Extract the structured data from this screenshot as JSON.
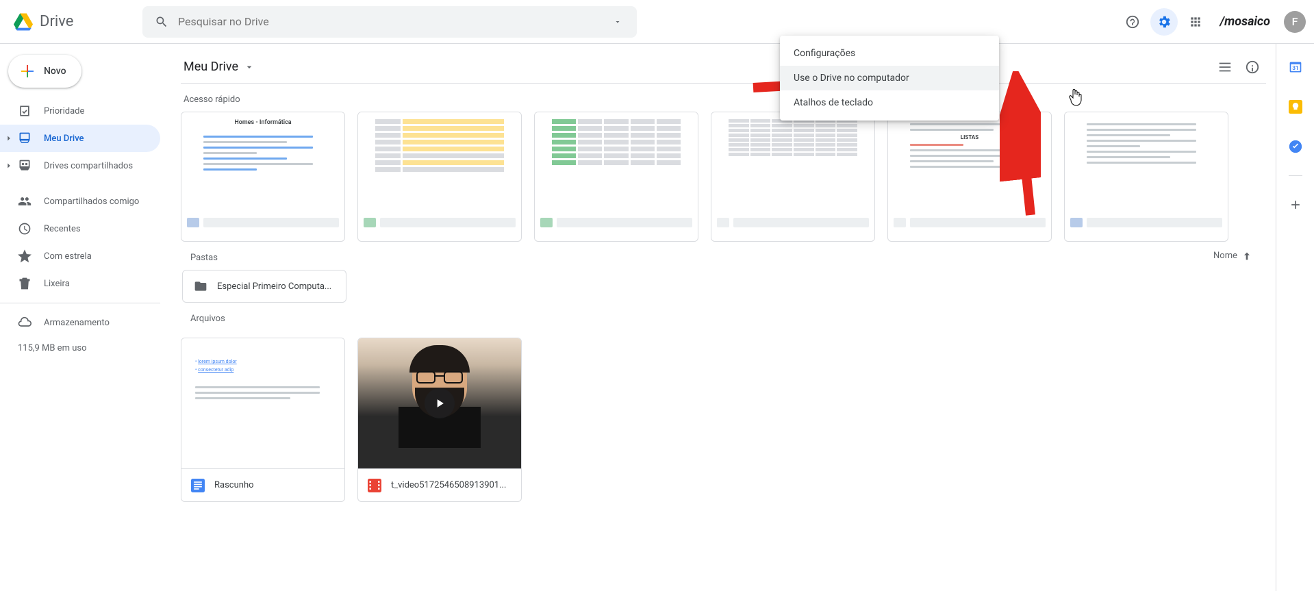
{
  "header": {
    "app_title": "Drive",
    "search_placeholder": "Pesquisar no Drive",
    "brand": "/mosaico",
    "avatar_initial": "F"
  },
  "sidebar": {
    "new_label": "Novo",
    "items": [
      {
        "label": "Prioridade"
      },
      {
        "label": "Meu Drive"
      },
      {
        "label": "Drives compartilhados"
      },
      {
        "label": "Compartilhados comigo"
      },
      {
        "label": "Recentes"
      },
      {
        "label": "Com estrela"
      },
      {
        "label": "Lixeira"
      },
      {
        "label": "Armazenamento"
      }
    ],
    "storage_used": "115,9 MB em uso"
  },
  "main": {
    "path_label": "Meu Drive",
    "quick_access_title": "Acesso rápido",
    "folders_title": "Pastas",
    "files_title": "Arquivos",
    "sort_label": "Nome",
    "folders": [
      {
        "name": "Especial Primeiro Computa..."
      }
    ],
    "quick_cards": [
      {
        "doc_heading": "Homes - Informática"
      },
      {
        "doc_heading": ""
      },
      {
        "doc_heading": ""
      },
      {
        "doc_heading": ""
      },
      {
        "doc_heading": "LISTAS"
      },
      {
        "doc_heading": ""
      }
    ],
    "files": [
      {
        "name": "Rascunho",
        "type": "docs"
      },
      {
        "name": "t_video5172546508913901...",
        "type": "video"
      }
    ]
  },
  "settings_menu": {
    "items": [
      "Configurações",
      "Use o Drive no computador",
      "Atalhos de teclado"
    ]
  },
  "colors": {
    "accent": "#1a73e8",
    "arrow": "#e5261e"
  }
}
